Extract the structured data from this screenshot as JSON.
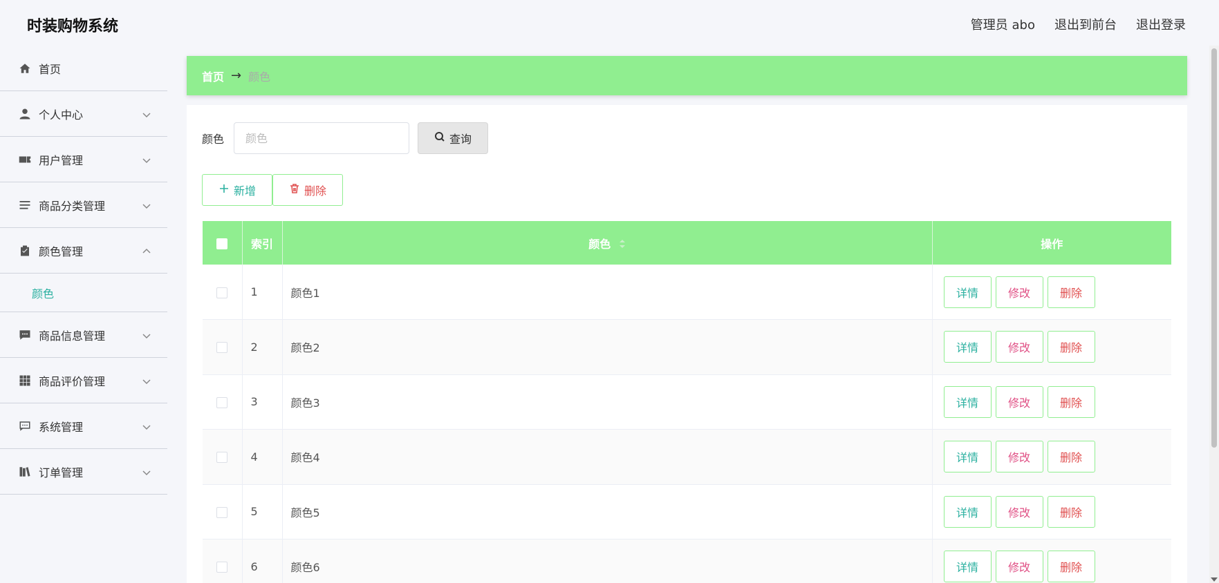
{
  "header": {
    "brand": "时装购物系统",
    "admin_label": "管理员 abo",
    "to_front": "退出到前台",
    "logout": "退出登录"
  },
  "sidebar": {
    "items": [
      {
        "label": "首页",
        "icon": "home-icon",
        "chevron": false
      },
      {
        "label": "个人中心",
        "icon": "user-icon",
        "chevron": "down"
      },
      {
        "label": "用户管理",
        "icon": "ticket-icon",
        "chevron": "down"
      },
      {
        "label": "商品分类管理",
        "icon": "list-icon",
        "chevron": "down"
      },
      {
        "label": "颜色管理",
        "icon": "clipboard-icon",
        "chevron": "up"
      },
      {
        "label": "商品信息管理",
        "icon": "message-icon",
        "chevron": "down"
      },
      {
        "label": "商品评价管理",
        "icon": "grid-icon",
        "chevron": "down"
      },
      {
        "label": "系统管理",
        "icon": "chat-icon",
        "chevron": "down"
      },
      {
        "label": "订单管理",
        "icon": "book-icon",
        "chevron": "down"
      }
    ],
    "active_sub": "颜色"
  },
  "breadcrumb": {
    "home": "首页",
    "arrow": "→",
    "current": "颜色"
  },
  "search": {
    "label": "颜色",
    "placeholder": "颜色",
    "button": "查询"
  },
  "actions": {
    "add": "新增",
    "delete": "删除"
  },
  "table": {
    "headers": {
      "index": "索引",
      "color": "颜色",
      "ops": "操作"
    },
    "rows": [
      {
        "index": "1",
        "color": "颜色1"
      },
      {
        "index": "2",
        "color": "颜色2"
      },
      {
        "index": "3",
        "color": "颜色3"
      },
      {
        "index": "4",
        "color": "颜色4"
      },
      {
        "index": "5",
        "color": "颜色5"
      },
      {
        "index": "6",
        "color": "颜色6"
      }
    ],
    "row_actions": {
      "detail": "详情",
      "edit": "修改",
      "delete": "删除"
    }
  },
  "colors": {
    "accent_green": "#90ee90",
    "teal": "#2bb0a0",
    "pink": "#e05085",
    "red": "#e05050"
  }
}
